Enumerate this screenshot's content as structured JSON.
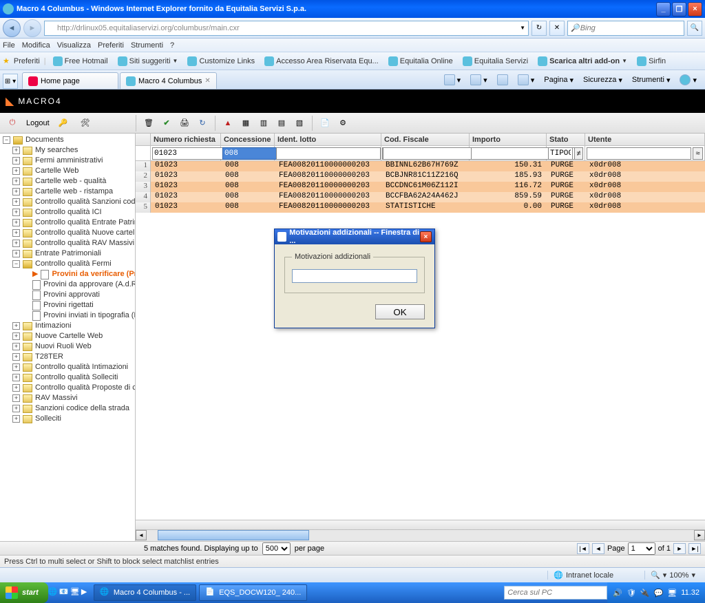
{
  "window": {
    "title": "Macro 4 Columbus - Windows Internet Explorer fornito da Equitalia Servizi S.p.a.",
    "min": "_",
    "max": "❐",
    "close": "×"
  },
  "nav": {
    "url": "http://drlinux05.equitaliaservizi.org/columbusr/main.cxr",
    "search_placeholder": "Bing",
    "search_btn": "🔍"
  },
  "menu": {
    "file": "File",
    "modifica": "Modifica",
    "visualizza": "Visualizza",
    "preferiti": "Preferiti",
    "strumenti": "Strumenti",
    "help": "?"
  },
  "fav": {
    "label": "Preferiti",
    "links": [
      "Free Hotmail",
      "Siti suggeriti",
      "Customize Links",
      "Accesso Area Riservata Equ...",
      "Equitalia Online",
      "Equitalia Servizi",
      "Scarica altri add-on",
      "Sirfin"
    ]
  },
  "tabs": {
    "t1": "Home page",
    "t2": "Macro 4 Columbus"
  },
  "cmdbar": {
    "pagina": "Pagina",
    "sicurezza": "Sicurezza",
    "strumenti": "Strumenti"
  },
  "brand": "MACRO4",
  "apptb": {
    "logout": "Logout"
  },
  "tree": {
    "root": "Documents",
    "items": [
      "My searches",
      "Fermi amministrativi",
      "Cartelle Web",
      "Cartelle web - qualità",
      "Cartelle web - ristampa",
      "Controllo qualità Sanzioni codice",
      "Controllo qualità ICI",
      "Controllo qualità Entrate Patrimo",
      "Controllo qualità Nuove cartelle",
      "Controllo qualità RAV Massivi",
      "Entrate Patrimoniali",
      "Controllo qualità Fermi"
    ],
    "fermi_children": [
      "Provini da verificare (Pro",
      "Provini da approvare (A.d.R.)",
      "Provini approvati",
      "Provini rigettati",
      "Provini inviati in tipografia (P"
    ],
    "items2": [
      "Intimazioni",
      "Nuove Cartelle Web",
      "Nuovi Ruoli Web",
      "T28TER",
      "Controllo qualità Intimazioni",
      "Controllo qualità Solleciti",
      "Controllo qualità Proposte di cor",
      "RAV Massivi",
      "Sanzioni codice della strada",
      "Solleciti"
    ]
  },
  "grid": {
    "headers": {
      "num": "Numero richiesta",
      "con": "Concessione",
      "lot": "Ident. lotto",
      "cf": "Cod. Fiscale",
      "imp": "Importo",
      "st": "Stato",
      "ut": "Utente"
    },
    "filters": {
      "num": "01023",
      "con": "008",
      "lot": "",
      "cf": "",
      "imp": "",
      "st": "TIPOG",
      "ut": ""
    },
    "rows": [
      {
        "n": "1",
        "num": "01023",
        "con": "008",
        "lot": "FEA00820110000000203",
        "cf": "BBINNL62B67H769Z",
        "imp": "150.31",
        "st": "PURGE",
        "ut": "x0dr008"
      },
      {
        "n": "2",
        "num": "01023",
        "con": "008",
        "lot": "FEA00820110000000203",
        "cf": "BCBJNR81C11Z216Q",
        "imp": "185.93",
        "st": "PURGE",
        "ut": "x0dr008"
      },
      {
        "n": "3",
        "num": "01023",
        "con": "008",
        "lot": "FEA00820110000000203",
        "cf": "BCCDNC61M06Z112I",
        "imp": "116.72",
        "st": "PURGE",
        "ut": "x0dr008"
      },
      {
        "n": "4",
        "num": "01023",
        "con": "008",
        "lot": "FEA00820110000000203",
        "cf": "BCCFBA62A24A462J",
        "imp": "859.59",
        "st": "PURGE",
        "ut": "x0dr008"
      },
      {
        "n": "5",
        "num": "01023",
        "con": "008",
        "lot": "FEA00820110000000203",
        "cf": "STATISTICHE",
        "imp": "0.00",
        "st": "PURGE",
        "ut": "x0dr008"
      }
    ]
  },
  "match": {
    "text_a": "5 matches found. Displaying up to",
    "sel": "500",
    "text_b": "per page",
    "page_lbl": "Page",
    "page_val": "1",
    "of": "of 1"
  },
  "hint": "Press Ctrl to multi select or Shift to block select matchlist entries",
  "iestatus": {
    "intranet": "Intranet locale",
    "zoom": "100%"
  },
  "taskbar": {
    "start": "start",
    "ql": [
      "🌐",
      "📧",
      "🖥",
      "▶"
    ],
    "tasks": [
      "Macro 4 Columbus - ...",
      "EQS_DOCW120_ 240..."
    ],
    "search_ph": "Cerca sul PC",
    "time": "11.32"
  },
  "dialog": {
    "title": "Motivazioni addizionali -- Finestra di ...",
    "legend": "Motivazioni addizionali",
    "ok": "OK",
    "close": "×"
  }
}
